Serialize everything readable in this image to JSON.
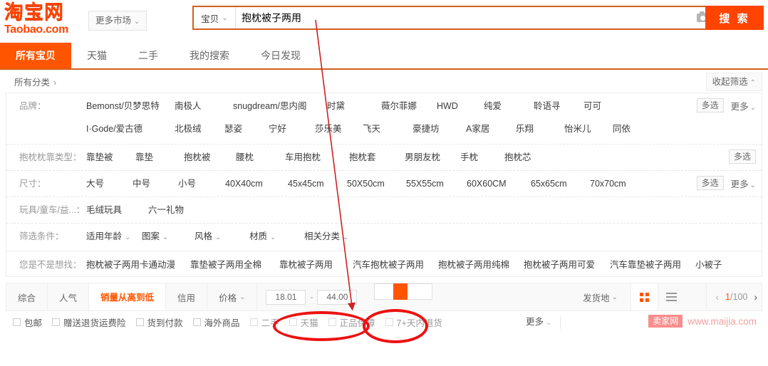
{
  "header": {
    "logo_cn": "淘宝网",
    "logo_en": "Taobao.com",
    "market_button": "更多市场",
    "category_select": "宝贝",
    "search_value": "抱枕被子两用",
    "search_placeholder": "",
    "camera_icon": "camera-icon",
    "search_button": "搜 索"
  },
  "tabs": [
    {
      "label": "所有宝贝",
      "active": true
    },
    {
      "label": "天猫",
      "active": false
    },
    {
      "label": "二手",
      "active": false
    },
    {
      "label": "我的搜索",
      "active": false
    },
    {
      "label": "今日发现",
      "active": false
    }
  ],
  "breadcrumb": {
    "label": "所有分类",
    "arrow": "›",
    "collapse_button": "收起筛选"
  },
  "filters": [
    {
      "label": "品牌：",
      "rows": [
        [
          "Bemonst/贝梦思特",
          "南极人",
          "snugdream/思内阁",
          "时黛",
          "薇尔菲娜",
          "HWD",
          "纯爱",
          "聆语寻",
          "可可"
        ],
        [
          "I·Gode/爱古德",
          "北极绒",
          "瑟姿",
          "宁好",
          "莎乐美",
          "飞天",
          "豪捷坊",
          "A家居",
          "乐翔",
          "怡米儿",
          "同依"
        ]
      ],
      "multi": "多选",
      "more": "更多"
    },
    {
      "label": "抱枕枕靠类型：",
      "rows": [
        [
          "靠垫被",
          "靠垫",
          "抱枕被",
          "腰枕",
          "车用抱枕",
          "抱枕套",
          "男朋友枕",
          "手枕",
          "抱枕芯"
        ]
      ],
      "multi": "多选",
      "more": ""
    },
    {
      "label": "尺寸：",
      "rows": [
        [
          "大号",
          "中号",
          "小号",
          "40X40cm",
          "45x45cm",
          "50X50cm",
          "55X55cm",
          "60X60CM",
          "65x65cm",
          "70x70cm"
        ]
      ],
      "multi": "多选",
      "more": "更多"
    },
    {
      "label": "玩具/童车/益...：",
      "rows": [
        [
          "毛绒玩具",
          "六一礼物"
        ]
      ],
      "multi": "",
      "more": ""
    },
    {
      "label": "筛选条件：",
      "rows": [
        [
          "适用年龄",
          "图案",
          "风格",
          "材质",
          "相关分类"
        ]
      ],
      "multi": "",
      "more": "",
      "dropdowns": true
    }
  ],
  "suggestion": {
    "label": "您是不是想找：",
    "items": [
      "抱枕被子两用卡通动漫",
      "靠垫被子两用全棉",
      "靠枕被子两用",
      "汽车抱枕被子两用",
      "抱枕被子两用纯棉",
      "抱枕被子两用可爱",
      "汽车靠垫被子两用",
      "小被子"
    ]
  },
  "sortbar": {
    "items": [
      {
        "label": "综合",
        "active": false,
        "caret": false
      },
      {
        "label": "人气",
        "active": false,
        "caret": false
      },
      {
        "label": "销量从高到低",
        "active": true,
        "caret": false
      },
      {
        "label": "信用",
        "active": false,
        "caret": false
      },
      {
        "label": "价格",
        "active": false,
        "caret": true
      }
    ],
    "price_min": "18.01",
    "price_max": "44.00",
    "price_dash": "-",
    "slider_icon": "price-slider",
    "ship_from": "发货地",
    "grid_view_icon": "grid-view-icon",
    "list_view_icon": "list-view-icon",
    "prev_icon": "chevron-left-icon",
    "next_icon": "chevron-right-icon",
    "page_current": "1",
    "page_separator": "/",
    "page_total": "100"
  },
  "checkboxes": [
    {
      "label": "包邮",
      "dim": false
    },
    {
      "label": "赠送退货运费险",
      "dim": false
    },
    {
      "label": "货到付款",
      "dim": false
    },
    {
      "label": "海外商品",
      "dim": false
    },
    {
      "label": "二手",
      "dim": true
    },
    {
      "label": "天猫",
      "dim": true
    },
    {
      "label": "正品保障",
      "dim": true
    },
    {
      "label": "7+天内退货",
      "dim": true
    }
  ],
  "more_filters": "更多",
  "watermark": {
    "badge": "卖家网",
    "url": "www.maijia.com"
  },
  "annotations": {
    "arrow_color": "#cc2222",
    "ellipse_color": "#ee1111",
    "ellipse_price_target": "price-range-inputs",
    "ellipse_slider_target": "price-slider-button"
  }
}
